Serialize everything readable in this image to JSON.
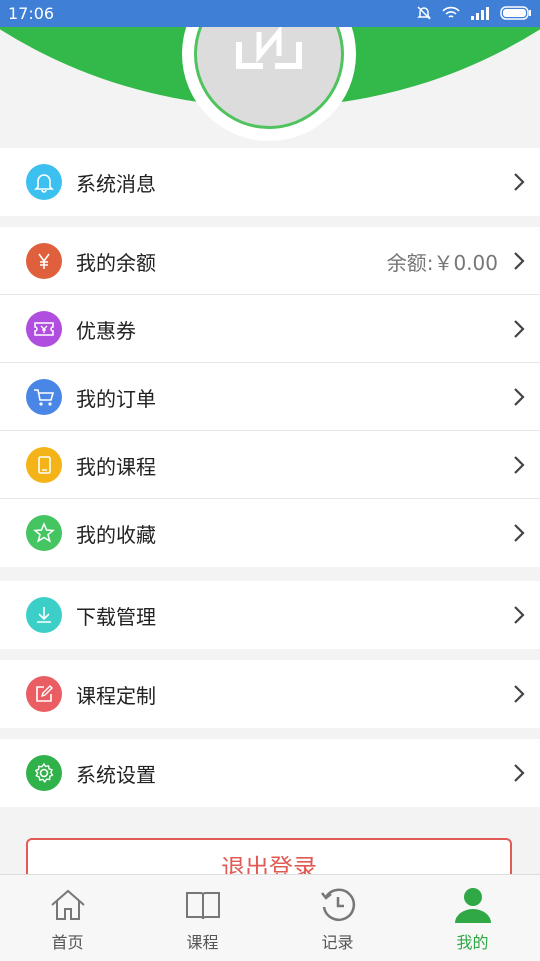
{
  "status_bar": {
    "time": "17:06"
  },
  "groups": [
    [
      {
        "label": "系统消息",
        "icon": "bell-icon",
        "color": "#3cc0ef"
      }
    ],
    [
      {
        "label": "我的余额",
        "icon": "yuan-icon",
        "color": "#e0603d",
        "value": "余额:￥0.00"
      },
      {
        "label": "优惠券",
        "icon": "coupon-icon",
        "color": "#b04ee0"
      },
      {
        "label": "我的订单",
        "icon": "cart-icon",
        "color": "#4a86e6"
      },
      {
        "label": "我的课程",
        "icon": "tablet-icon",
        "color": "#f4b418"
      },
      {
        "label": "我的收藏",
        "icon": "star-icon",
        "color": "#45c561"
      }
    ],
    [
      {
        "label": "下载管理",
        "icon": "download-icon",
        "color": "#3bcfc7"
      }
    ],
    [
      {
        "label": "课程定制",
        "icon": "edit-icon",
        "color": "#ea5d62"
      }
    ],
    [
      {
        "label": "系统设置",
        "icon": "gear-icon",
        "color": "#30b24b"
      }
    ]
  ],
  "logout_label": "退出登录",
  "tabs": [
    {
      "label": "首页",
      "icon": "home-icon",
      "active": false
    },
    {
      "label": "课程",
      "icon": "book-icon",
      "active": false
    },
    {
      "label": "记录",
      "icon": "history-icon",
      "active": false
    },
    {
      "label": "我的",
      "icon": "profile-icon",
      "active": true
    }
  ],
  "colors": {
    "accent": "#33b94a",
    "status_bar": "#3f7fd6",
    "logout": "#e15a55"
  }
}
